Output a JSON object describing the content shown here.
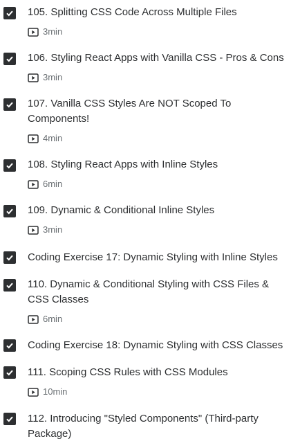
{
  "curriculum": {
    "items": [
      {
        "title": "105. Splitting CSS Code Across Multiple Files",
        "duration": "3min",
        "icon": "play-video-icon",
        "completed": true
      },
      {
        "title": "106. Styling React Apps with Vanilla CSS - Pros & Cons",
        "duration": "3min",
        "icon": "play-video-icon",
        "completed": true
      },
      {
        "title": "107. Vanilla CSS Styles Are NOT Scoped To Components!",
        "duration": "4min",
        "icon": "play-video-icon",
        "completed": true
      },
      {
        "title": "108. Styling React Apps with Inline Styles",
        "duration": "6min",
        "icon": "play-video-icon",
        "completed": true
      },
      {
        "title": "109. Dynamic & Conditional Inline Styles",
        "duration": "3min",
        "icon": "play-video-icon",
        "completed": true
      },
      {
        "title": "Coding Exercise 17: Dynamic Styling with Inline Styles",
        "completed": true
      },
      {
        "title": "110. Dynamic & Conditional Styling with CSS Files & CSS Classes",
        "duration": "6min",
        "icon": "play-video-icon",
        "completed": true
      },
      {
        "title": "Coding Exercise 18: Dynamic Styling with CSS Classes",
        "completed": true
      },
      {
        "title": "111. Scoping CSS Rules with CSS Modules",
        "duration": "10min",
        "icon": "play-video-icon",
        "completed": true
      },
      {
        "title": "112. Introducing \"Styled Components\" (Third-party Package)",
        "completed": true
      }
    ]
  },
  "colors": {
    "text": "#2d2f31",
    "muted": "#6a6f73",
    "checkbox": "#2d2f31"
  }
}
